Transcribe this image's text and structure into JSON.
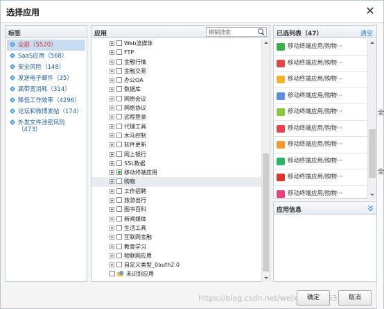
{
  "dialog": {
    "title": "选择应用",
    "close_glyph": "✕"
  },
  "side_strip": {
    "fragments": [
      "全",
      "全"
    ]
  },
  "label_panel": {
    "header": "标签",
    "items": [
      {
        "label": "全部（5520）",
        "selected": true
      },
      {
        "label": "SaaS应用（568）",
        "selected": false
      },
      {
        "label": "安全风险（148）",
        "selected": false
      },
      {
        "label": "发送电子邮件（35）",
        "selected": false
      },
      {
        "label": "高带宽消耗（314）",
        "selected": false
      },
      {
        "label": "降低工作效率（4296）",
        "selected": false
      },
      {
        "label": "论坛和微博发帖（174）",
        "selected": false
      },
      {
        "label": "外发文件泄密风险（473）",
        "selected": false
      }
    ]
  },
  "app_panel": {
    "header": "应用",
    "search": {
      "placeholder": "模糊搜索",
      "icon": "search-icon"
    },
    "tree": [
      {
        "label": "Web流媒体",
        "state": "none"
      },
      {
        "label": "FTP",
        "state": "none"
      },
      {
        "label": "金融行情",
        "state": "none"
      },
      {
        "label": "金融交易",
        "state": "none"
      },
      {
        "label": "办公OA",
        "state": "none"
      },
      {
        "label": "数据库",
        "state": "none"
      },
      {
        "label": "网络会议",
        "state": "none"
      },
      {
        "label": "网络协议",
        "state": "none"
      },
      {
        "label": "远程登录",
        "state": "none"
      },
      {
        "label": "代理工具",
        "state": "none"
      },
      {
        "label": "木马控制",
        "state": "none"
      },
      {
        "label": "软件更新",
        "state": "none"
      },
      {
        "label": "网上银行",
        "state": "none"
      },
      {
        "label": "SSL数据",
        "state": "none"
      },
      {
        "label": "移动终端应用",
        "state": "partial"
      },
      {
        "label": "购物",
        "state": "none",
        "highlighted": true
      },
      {
        "label": "工作招聘",
        "state": "none"
      },
      {
        "label": "旅游出行",
        "state": "none"
      },
      {
        "label": "图书百科",
        "state": "none"
      },
      {
        "label": "新闻媒体",
        "state": "none"
      },
      {
        "label": "生活工具",
        "state": "none"
      },
      {
        "label": "互联网金融",
        "state": "none"
      },
      {
        "label": "教育学习",
        "state": "none"
      },
      {
        "label": "物联网应用",
        "state": "none"
      },
      {
        "label": "自定义类型_0auth2.0",
        "state": "none"
      }
    ],
    "unknown_app": {
      "label": "未识别应用"
    }
  },
  "selected_panel": {
    "header": "已选列表（47）",
    "clear_label": "清空",
    "items": [
      {
        "label": "移动终端应用/购物···",
        "icon_color": "#3cae4a"
      },
      {
        "label": "移动终端应用/购物···",
        "icon_color": "#e04848"
      },
      {
        "label": "移动终端应用/购物···",
        "icon_color": "#f0b32a"
      },
      {
        "label": "移动终端应用/购物···",
        "icon_color": "#5b8fd8"
      },
      {
        "label": "移动终端应用/购物···",
        "icon_color": "#8cc63f"
      },
      {
        "label": "移动终端应用/购物···",
        "icon_color": "#e8424e"
      },
      {
        "label": "移动终端应用/购物···",
        "icon_color": "#f29a2e"
      },
      {
        "label": "移动终端应用/购物···",
        "icon_color": "#2db36a"
      },
      {
        "label": "移动终端应用/购物···",
        "icon_color": "#d9342b"
      },
      {
        "label": "移动终端应用/购物···",
        "icon_color": "#e8417a"
      }
    ]
  },
  "info_panel": {
    "header": "应用信息"
  },
  "footer": {
    "ok_label": "确定",
    "cancel_label": "取消",
    "watermark": "https://blog.csdn.net/weixin_43706319"
  }
}
